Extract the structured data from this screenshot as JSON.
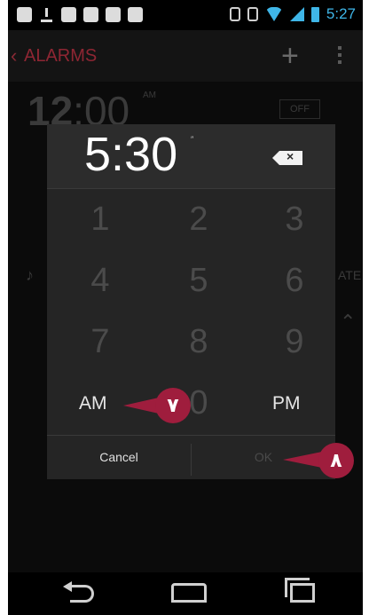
{
  "status_bar": {
    "time": "5:27"
  },
  "app_bar": {
    "title": "ALARMS",
    "add_label": "+"
  },
  "background_alarm": {
    "time_hour": "12",
    "time_rest": ":00",
    "ampm": "AM",
    "toggle": "OFF",
    "partial_label": "ATE"
  },
  "dialog": {
    "time": "5:30",
    "keys": [
      "1",
      "2",
      "3",
      "4",
      "5",
      "6",
      "7",
      "8",
      "9"
    ],
    "key_zero": "0",
    "am": "AM",
    "pm": "PM",
    "cancel": "Cancel",
    "ok": "OK"
  },
  "callouts": {
    "am": "٧",
    "ok": "٨"
  },
  "colors": {
    "accent": "#8e2633",
    "callout": "#9f1d3d",
    "blue": "#3fb6e8"
  }
}
